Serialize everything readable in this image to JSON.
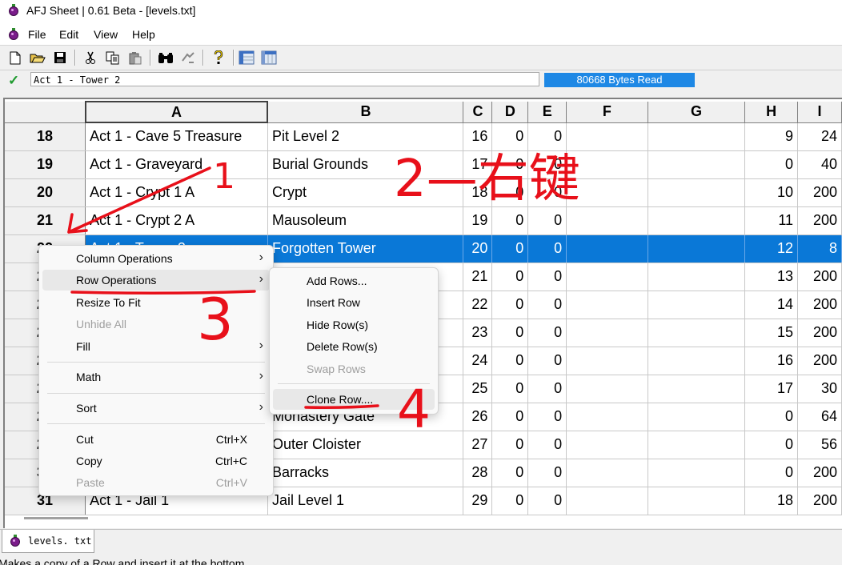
{
  "window": {
    "title": "AFJ Sheet | 0.61 Beta - [levels.txt]"
  },
  "menubar": [
    "File",
    "Edit",
    "View",
    "Help"
  ],
  "formula_bar": {
    "cell_value": "Act 1 - Tower 2",
    "bytes_read": "80668 Bytes Read"
  },
  "grid": {
    "columns": [
      "A",
      "B",
      "C",
      "D",
      "E",
      "F",
      "G",
      "H",
      "I"
    ],
    "rows": [
      {
        "num": "18",
        "a": "Act 1 - Cave 5 Treasure",
        "b": "Pit Level 2",
        "c": "16",
        "d": "0",
        "e": "0",
        "f": "",
        "g": "",
        "h": "9",
        "i": "24"
      },
      {
        "num": "19",
        "a": "Act 1 - Graveyard",
        "b": "Burial Grounds",
        "c": "17",
        "d": "0",
        "e": "0",
        "f": "",
        "g": "",
        "h": "0",
        "i": "40"
      },
      {
        "num": "20",
        "a": "Act 1 - Crypt 1 A",
        "b": "Crypt",
        "c": "18",
        "d": "0",
        "e": "0",
        "f": "",
        "g": "",
        "h": "10",
        "i": "200"
      },
      {
        "num": "21",
        "a": "Act 1 - Crypt 2 A",
        "b": "Mausoleum",
        "c": "19",
        "d": "0",
        "e": "0",
        "f": "",
        "g": "",
        "h": "11",
        "i": "200"
      },
      {
        "num": "22",
        "a": "Act 1 - Tower 2",
        "b": "Forgotten Tower",
        "c": "20",
        "d": "0",
        "e": "0",
        "f": "",
        "g": "",
        "h": "12",
        "i": "8"
      },
      {
        "num": "23",
        "a": "",
        "b": "",
        "c": "21",
        "d": "0",
        "e": "0",
        "f": "",
        "g": "",
        "h": "13",
        "i": "200"
      },
      {
        "num": "24",
        "a": "",
        "b": "",
        "c": "22",
        "d": "0",
        "e": "0",
        "f": "",
        "g": "",
        "h": "14",
        "i": "200"
      },
      {
        "num": "25",
        "a": "",
        "b": "",
        "c": "23",
        "d": "0",
        "e": "0",
        "f": "",
        "g": "",
        "h": "15",
        "i": "200"
      },
      {
        "num": "26",
        "a": "",
        "b": "",
        "c": "24",
        "d": "0",
        "e": "0",
        "f": "",
        "g": "",
        "h": "16",
        "i": "200"
      },
      {
        "num": "27",
        "a": "",
        "b": "",
        "c": "25",
        "d": "0",
        "e": "0",
        "f": "",
        "g": "",
        "h": "17",
        "i": "30"
      },
      {
        "num": "28",
        "a": "",
        "b": "Monastery Gate",
        "c": "26",
        "d": "0",
        "e": "0",
        "f": "",
        "g": "",
        "h": "0",
        "i": "64"
      },
      {
        "num": "29",
        "a": "",
        "b": "Outer Cloister",
        "c": "27",
        "d": "0",
        "e": "0",
        "f": "",
        "g": "",
        "h": "0",
        "i": "56"
      },
      {
        "num": "30",
        "a": "",
        "b": "Barracks",
        "c": "28",
        "d": "0",
        "e": "0",
        "f": "",
        "g": "",
        "h": "0",
        "i": "200"
      },
      {
        "num": "31",
        "a": "Act 1 - Jail 1",
        "b": "Jail Level 1",
        "c": "29",
        "d": "0",
        "e": "0",
        "f": "",
        "g": "",
        "h": "18",
        "i": "200"
      }
    ],
    "selected_row": "22"
  },
  "context_menu": {
    "items": [
      {
        "label": "Column Operations",
        "submenu": true
      },
      {
        "label": "Row Operations",
        "submenu": true,
        "highlighted": true
      },
      {
        "label": "Resize To Fit"
      },
      {
        "label": "Unhide All",
        "disabled": true
      },
      {
        "label": "Fill",
        "submenu": true
      },
      {
        "label": "Math",
        "submenu": true
      },
      {
        "label": "Sort",
        "submenu": true
      },
      {
        "label": "Cut",
        "shortcut": "Ctrl+X"
      },
      {
        "label": "Copy",
        "shortcut": "Ctrl+C"
      },
      {
        "label": "Paste",
        "shortcut": "Ctrl+V",
        "disabled": true
      }
    ]
  },
  "row_submenu": {
    "items": [
      {
        "label": "Add Rows..."
      },
      {
        "label": "Insert Row"
      },
      {
        "label": "Hide Row(s)"
      },
      {
        "label": "Delete Row(s)"
      },
      {
        "label": "Swap Rows",
        "disabled": true
      },
      {
        "label": "Clone Row....",
        "highlighted": true
      }
    ]
  },
  "annotations": [
    "1",
    "2—右键",
    "3",
    "4"
  ],
  "annotation_color": "#e8101a",
  "selection_color": "#0a78d7",
  "sheet_tab": {
    "label": "levels. txt"
  },
  "status_bar": {
    "text": "Makes a copy of a Row and insert it at the bottom"
  }
}
